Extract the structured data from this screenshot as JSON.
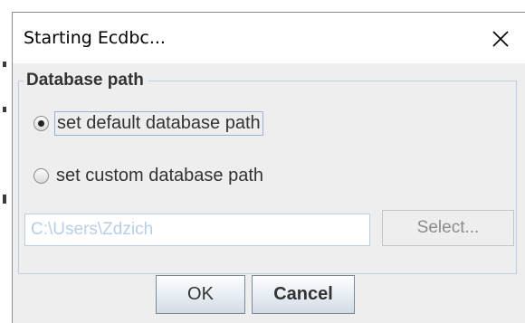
{
  "window": {
    "title": "Starting Ecdbc...",
    "close_icon": "close-icon"
  },
  "group": {
    "legend": "Database path",
    "options": [
      {
        "label": "set default database path",
        "checked": true
      },
      {
        "label": "set custom database path",
        "checked": false
      }
    ],
    "path_value": "C:\\Users\\Zdzich",
    "select_label": "Select..."
  },
  "buttons": {
    "ok_label": "OK",
    "cancel_label": "Cancel"
  },
  "colors": {
    "dialog_bg": "#eeeeee",
    "border_accent": "#b8cfe5",
    "disabled_text": "#8c8c8c"
  }
}
